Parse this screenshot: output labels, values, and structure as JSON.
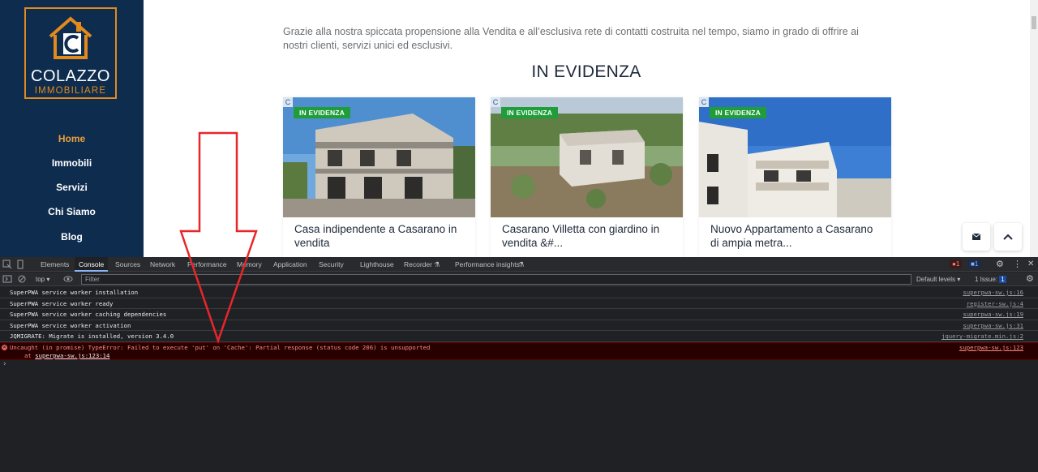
{
  "site": {
    "logo": {
      "name": "COLAZZO",
      "sub": "IMMOBILIARE"
    },
    "nav": [
      "Home",
      "Immobili",
      "Servizi",
      "Chi Siamo",
      "Blog"
    ],
    "intro": "Grazie alla nostra spiccata propensione alla Vendita e all’esclusiva rete di contatti costruita nel tempo, siamo in grado di offrire ai nostri clienti, servizi unici ed esclusivi.",
    "heading": "IN EVIDENZA",
    "cards": [
      {
        "badge": "IN EVIDENZA",
        "title": "Casa indipendente a Casarano in vendita"
      },
      {
        "badge": "IN EVIDENZA",
        "title": "Casarano Villetta con giardino in vendita &#..."
      },
      {
        "badge": "IN EVIDENZA",
        "title": "Nuovo Appartamento a Casarano di ampia metra..."
      }
    ],
    "float_buttons": {
      "mail": "mail-icon",
      "top": "chevron-up-icon"
    },
    "colors": {
      "sidebar": "#0e2c4e",
      "accent": "#e28a1d",
      "badge": "#1f9d3a"
    }
  },
  "devtools": {
    "tabs": [
      "Elements",
      "Console",
      "Sources",
      "Network",
      "Performance",
      "Memory",
      "Application",
      "Security",
      "Lighthouse",
      "Recorder",
      "Performance insights"
    ],
    "active_tab": "Console",
    "error_count": "1",
    "message_count": "1",
    "context": "top",
    "filter_placeholder": "Filter",
    "levels": "Default levels",
    "issues": "1 Issue:",
    "issues_count": "1",
    "logs": [
      {
        "text": "SuperPWA service worker installation",
        "src": "superpwa-sw.js:16"
      },
      {
        "text": "SuperPWA service worker ready",
        "src": "register-sw.js:4"
      },
      {
        "text": "SuperPWA service worker caching dependencies",
        "src": "superpwa-sw.js:19"
      },
      {
        "text": "SuperPWA service worker activation",
        "src": "superpwa-sw.js:31"
      },
      {
        "text": "JQMIGRATE: Migrate is installed, version 3.4.0",
        "src": "jquery-migrate.min.js:2"
      }
    ],
    "error": {
      "text": "Uncaught (in promise) TypeError: Failed to execute 'put' on 'Cache': Partial response (status code 206) is unsupported",
      "at": "at ",
      "link": "superpwa-sw.js:123:14",
      "src": "superpwa-sw.js:123"
    },
    "prompt": "›"
  }
}
